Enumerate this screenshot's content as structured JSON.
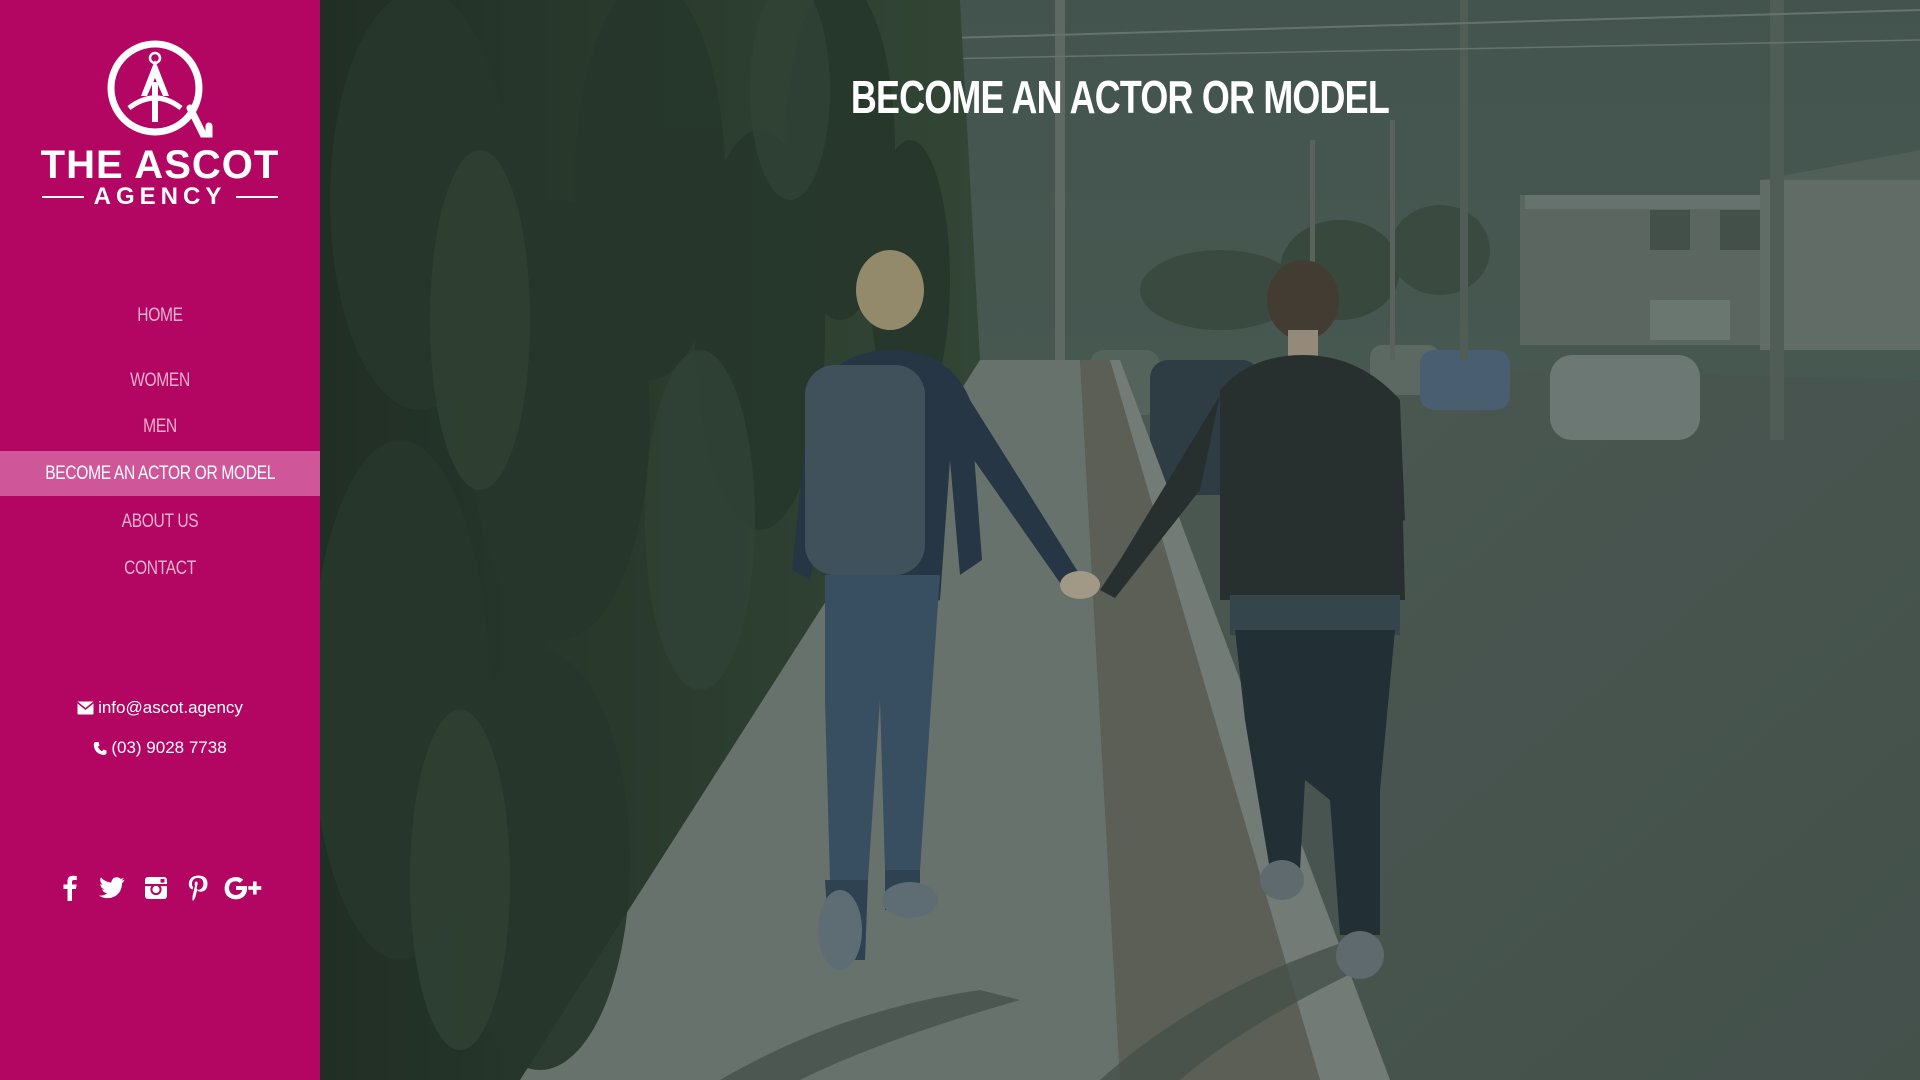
{
  "brand": {
    "name_line1": "THE ASCOT",
    "name_line2": "AGENCY"
  },
  "nav": {
    "items": [
      {
        "label": "HOME",
        "active": false
      },
      {
        "label": "WOMEN",
        "active": false
      },
      {
        "label": "MEN",
        "active": false
      },
      {
        "label": "BECOME AN ACTOR OR MODEL",
        "active": true
      },
      {
        "label": "ABOUT US",
        "active": false
      },
      {
        "label": "CONTACT",
        "active": false
      }
    ]
  },
  "contact": {
    "email": "info@ascot.agency",
    "email_icon": "envelope-icon",
    "phone": "(03) 9028 7738",
    "phone_icon": "phone-icon"
  },
  "social": {
    "icons": [
      "facebook-icon",
      "twitter-icon",
      "instagram-icon",
      "pinterest-icon",
      "google-plus-icon"
    ]
  },
  "hero": {
    "title": "BECOME AN ACTOR OR MODEL",
    "image_icon": "couple-walking-photo"
  },
  "colors": {
    "sidebar": "#b30663",
    "nav_active": "#d0569a",
    "nav_text": "#e9b3cf",
    "hero_overlay": "#2b3a33"
  }
}
